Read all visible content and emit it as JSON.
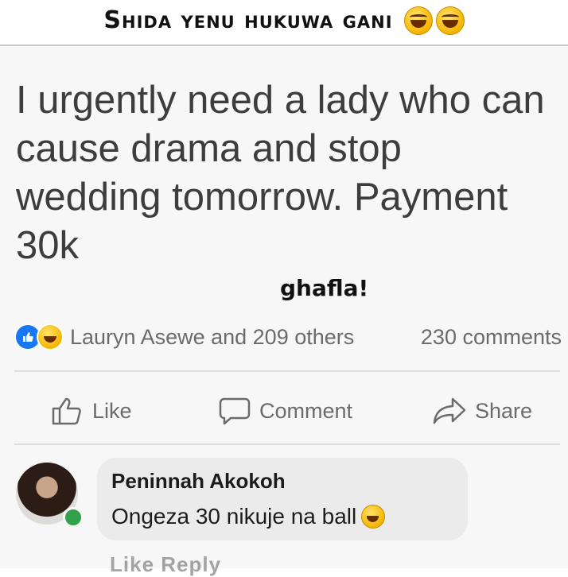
{
  "banner": {
    "title": "Shida yenu hukuwa gani",
    "emoji": [
      "rolling-on-floor-laughing-icon",
      "rolling-on-floor-laughing-icon"
    ]
  },
  "post": {
    "text": "I urgently need a lady who can cause drama and stop wedding tomorrow. Payment 30k",
    "watermark": "ghafla!"
  },
  "stats": {
    "reactions": [
      "like-reaction-icon",
      "haha-reaction-icon"
    ],
    "reactors": "Lauryn Asewe and 209 others",
    "comments": "230 comments"
  },
  "actions": {
    "like": "Like",
    "comment": "Comment",
    "share": "Share"
  },
  "comment": {
    "author": "Peninnah Akokoh",
    "text": "Ongeza 30 nikuje na ball",
    "emoji": "rolling-on-floor-laughing-icon",
    "online": true
  },
  "comment_actions_partial": "Like   Reply",
  "colors": {
    "accent": "#1877f2",
    "online": "#31a24c",
    "text_muted": "#6b6b6b",
    "bubble": "#ebebeb"
  }
}
